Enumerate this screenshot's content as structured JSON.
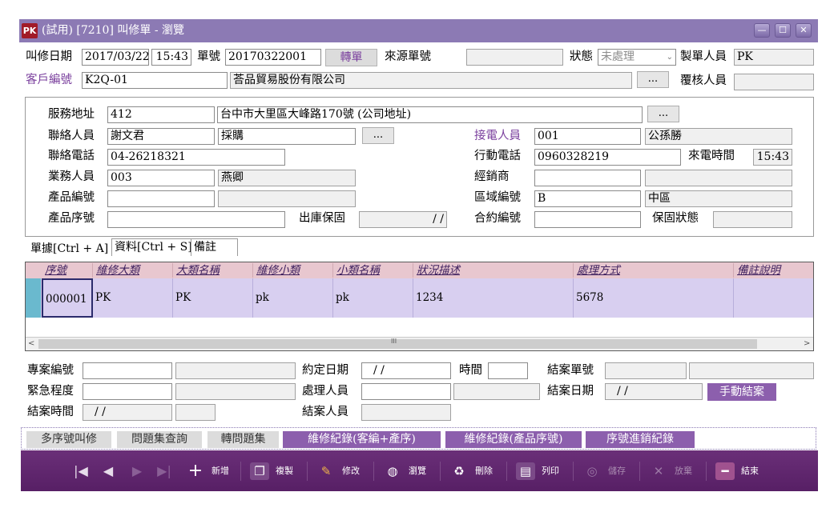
{
  "window": {
    "icon_text": "PK",
    "title": "(試用) [7210] 叫修單 - 瀏覽",
    "min": "—",
    "max": "☐",
    "close": "✕"
  },
  "header": {
    "date_label": "叫修日期",
    "date": "2017/03/22",
    "time": "15:43",
    "order_no_label": "單號",
    "order_no": "20170322001",
    "transfer_button": "轉單",
    "source_no_label": "來源單號",
    "source_no": "",
    "status_label": "狀態",
    "status": "未處理",
    "creator_label": "製單人員",
    "creator": "PK",
    "customer_label": "客戶編號",
    "customer_code": "K2Q-01",
    "customer_name": "荅品貿易股份有限公司",
    "dots": "...",
    "reviewer_label": "覆核人員",
    "reviewer": ""
  },
  "detail": {
    "address_label": "服務地址",
    "address_code": "412",
    "address": "台中市大里區大峰路170號 (公司地址)",
    "contact_label": "聯絡人員",
    "contact_name": "謝文君",
    "contact_title": "採購",
    "receiver_label": "接電人員",
    "receiver_code": "001",
    "receiver_name": "公孫勝",
    "phone_label": "聯絡電話",
    "phone": "04-26218321",
    "mobile_label": "行動電話",
    "mobile": "0960328219",
    "call_time_label": "來電時間",
    "call_time": "15:43",
    "sales_label": "業務人員",
    "sales_code": "003",
    "sales_name": "燕卿",
    "dealer_label": "經銷商",
    "dealer_code": "",
    "dealer_name": "",
    "product_code_label": "產品編號",
    "product_code": "",
    "product_name": "",
    "region_label": "區域編號",
    "region_code": "B",
    "region_name": "中區",
    "serial_label": "產品序號",
    "serial": "",
    "warranty_label": "出庫保固",
    "warranty": "/ /",
    "contract_label": "合約編號",
    "contract": "",
    "warranty_status_label": "保固狀態",
    "warranty_status": "",
    "dots": "..."
  },
  "tabs": [
    "單據[Ctrl + A]",
    "資料[Ctrl + S]",
    "備註"
  ],
  "grid": {
    "columns": [
      "序號",
      "維修大類",
      "大類名稱",
      "維修小類",
      "小類名稱",
      "狀況描述",
      "處理方式",
      "備註說明"
    ],
    "rows": [
      [
        "000001",
        "PK",
        "PK",
        "pk",
        "pk",
        "1234",
        "5678",
        ""
      ]
    ],
    "scroll_left": "<",
    "scroll_mid": "III",
    "scroll_right": ">"
  },
  "lower": {
    "project_label": "專案編號",
    "project_code": "",
    "project_name": "",
    "appoint_date_label": "約定日期",
    "appoint_date": "/ /",
    "time_label": "時間",
    "time": "",
    "close_no_label": "結案單號",
    "close_no": "",
    "close_no2": "",
    "urgency_label": "緊急程度",
    "urgency_code": "",
    "urgency_name": "",
    "handler_label": "處理人員",
    "handler_code": "",
    "handler_name": "",
    "close_date_label": "結案日期",
    "close_date": "/ /",
    "manual_close_button": "手動結案",
    "close_time_label": "結案時間",
    "close_time": "/ /",
    "close_time2": "",
    "closer_label": "結案人員",
    "closer": ""
  },
  "tool_tabs": [
    "多序號叫修",
    "問題集查詢",
    "轉問題集",
    "維修紀錄(客編+產序)",
    "維修紀錄(產品序號)",
    "序號進銷紀錄"
  ],
  "toolbar": {
    "first": "|◀",
    "prev": "◀",
    "next": "▶",
    "last": "▶|",
    "buttons": [
      "新增",
      "複製",
      "修改",
      "瀏覽",
      "刪除",
      "列印",
      "儲存",
      "放棄",
      "結束"
    ]
  },
  "colors": {
    "title_bar": "#8c7ab4",
    "toolbar": "#5e2569",
    "accent_purple": "#8c5fad",
    "grid_header": "#e8c7cf",
    "grid_row": "#d8cff0"
  }
}
